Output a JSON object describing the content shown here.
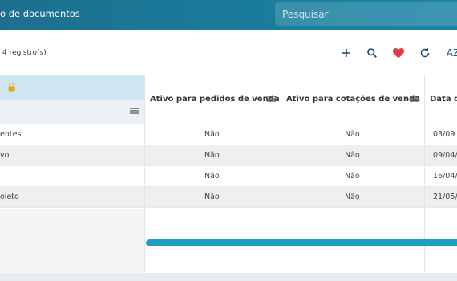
{
  "header": {
    "title": "o de documentos",
    "search_placeholder": "Pesquisar"
  },
  "toolbar": {
    "record_count": "4 registro(s)",
    "actions": [
      {
        "name": "add-button",
        "icon": "plus-icon"
      },
      {
        "name": "search-button",
        "icon": "search-icon"
      },
      {
        "name": "favorite-button",
        "icon": "heart-icon",
        "color": "#e53945"
      },
      {
        "name": "refresh-button",
        "icon": "refresh-icon"
      },
      {
        "name": "sort-button",
        "icon": "sort-az-icon",
        "label": "AZ"
      }
    ]
  },
  "grid": {
    "columns": [
      {
        "label": "Ativo para pedidos de venda"
      },
      {
        "label": "Ativo para cotações de venda"
      },
      {
        "label": "Data d"
      }
    ],
    "rows": [
      {
        "name": "entes",
        "pedidos": "Não",
        "cotacoes": "Não",
        "data": "03/09"
      },
      {
        "name": "vo",
        "pedidos": "Não",
        "cotacoes": "Não",
        "data": "09/04/"
      },
      {
        "name": "",
        "pedidos": "Não",
        "cotacoes": "Não",
        "data": "16/04/"
      },
      {
        "name": "oleto",
        "pedidos": "Não",
        "cotacoes": "Não",
        "data": "21/05/"
      }
    ]
  },
  "colors": {
    "topbar": "#1a7c9c",
    "frozen_header": "#cde6f1",
    "accent_scroll": "#1f9ec3",
    "heart": "#e53945",
    "lock": "#e6a817"
  }
}
